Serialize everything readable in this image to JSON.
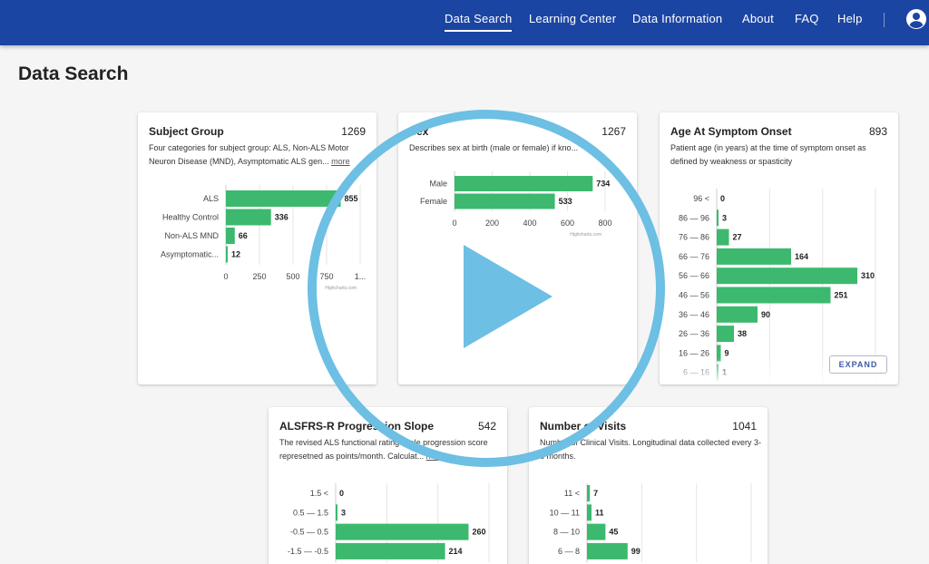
{
  "nav": {
    "items": [
      {
        "label": "Data Search",
        "active": true
      },
      {
        "label": "Learning Center",
        "active": false
      },
      {
        "label": "Data Information",
        "active": false
      },
      {
        "label": "About",
        "active": false
      },
      {
        "label": "FAQ",
        "active": false
      },
      {
        "label": "Help",
        "active": false
      }
    ],
    "account_icon": "account-circle-icon"
  },
  "page": {
    "title": "Data Search"
  },
  "colors": {
    "header": "#1b45a3",
    "bar": "#3cb96e",
    "play": "#6dbfe3"
  },
  "cards": {
    "subject": {
      "title": "Subject Group",
      "count": "1269",
      "desc": "Four categories for subject group: ALS, Non-ALS Motor Neuron Disease (MND), Asymptomatic ALS gen...",
      "more": "more",
      "credit": "Highcharts.com"
    },
    "sex": {
      "title": "Sex",
      "count": "1267",
      "desc": "Describes sex at birth (male or female) if kno...",
      "credit": "Highcharts.com"
    },
    "age": {
      "title": "Age At Symptom Onset",
      "count": "893",
      "desc": "Patient age (in years) at the time of symptom onset as defined by weakness or spasticity",
      "expand": "EXPAND"
    },
    "alsfrs": {
      "title": "ALSFRS-R Progression Slope",
      "count": "542",
      "desc": "The revised ALS functional rating scale progression score represetned as points/month. Calculat...",
      "more": "more"
    },
    "visits": {
      "title": "Number of Visits",
      "count": "1041",
      "desc": "Number of Clinical Visits. Longitudinal data collected every 3-6 months."
    }
  },
  "chart_data": [
    {
      "type": "bar",
      "orientation": "horizontal",
      "categories": [
        "ALS",
        "Healthy Control",
        "Non-ALS MND",
        "Asymptomatic..."
      ],
      "values": [
        855,
        336,
        66,
        12
      ],
      "value_labels": [
        "855",
        "336",
        "66",
        "12"
      ],
      "xticks": [
        "0",
        "250",
        "500",
        "750",
        "1..."
      ],
      "xlim": [
        0,
        1000
      ],
      "color": "#3cb96e"
    },
    {
      "type": "bar",
      "orientation": "horizontal",
      "categories": [
        "Male",
        "Female"
      ],
      "values": [
        734,
        533
      ],
      "value_labels": [
        "734",
        "533"
      ],
      "xticks": [
        "0",
        "200",
        "400",
        "600",
        "800"
      ],
      "xlim": [
        0,
        800
      ],
      "color": "#3cb96e"
    },
    {
      "type": "bar",
      "orientation": "horizontal",
      "categories": [
        "96 <",
        "86 — 96",
        "76 — 86",
        "66 — 76",
        "56 — 66",
        "46 — 56",
        "36 — 46",
        "26 — 36",
        "16 — 26",
        "6 — 16"
      ],
      "values": [
        0,
        3,
        27,
        164,
        310,
        251,
        90,
        38,
        9,
        1
      ],
      "value_labels": [
        "0",
        "3",
        "27",
        "164",
        "310",
        "251",
        "90",
        "38",
        "9",
        "1"
      ],
      "xlim": [
        0,
        350
      ],
      "color": "#3cb96e"
    },
    {
      "type": "bar",
      "orientation": "horizontal",
      "categories": [
        "1.5 <",
        "0.5 — 1.5",
        "-0.5 — 0.5",
        "-1.5 — -0.5"
      ],
      "values": [
        0,
        3,
        260,
        214
      ],
      "value_labels": [
        "0",
        "3",
        "260",
        "214"
      ],
      "xlim": [
        0,
        300
      ],
      "color": "#3cb96e"
    },
    {
      "type": "bar",
      "orientation": "horizontal",
      "categories": [
        "11 <",
        "10 — 11",
        "8 — 10",
        "6 — 8"
      ],
      "values": [
        7,
        11,
        45,
        99
      ],
      "value_labels": [
        "7",
        "11",
        "45",
        "99"
      ],
      "xlim": [
        0,
        400
      ],
      "color": "#3cb96e"
    }
  ]
}
